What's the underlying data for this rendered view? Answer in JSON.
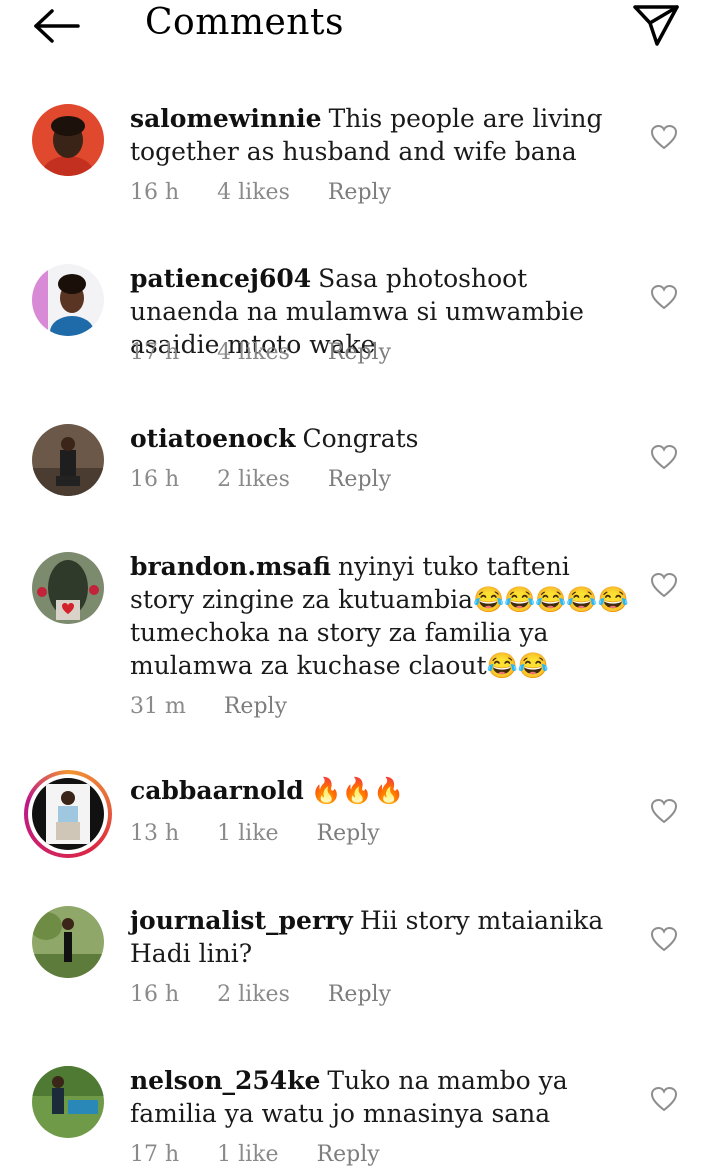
{
  "header": {
    "title": "Comments",
    "back_icon": "arrow-left-icon",
    "send_icon": "paper-plane-icon"
  },
  "comments": [
    {
      "username": "salomewinnie",
      "text": "This people are living together as husband and wife bana",
      "time": "16 h",
      "likes": "4 likes",
      "reply": "Reply"
    },
    {
      "username": "patiencej604",
      "text": "Sasa photoshoot unaenda na mulamwa si umwambie asaidie mtoto wake",
      "time": "17 h",
      "likes": "4 likes",
      "reply": "Reply"
    },
    {
      "username": "otiatoenock",
      "text": "Congrats",
      "time": "16 h",
      "likes": "2 likes",
      "reply": "Reply"
    },
    {
      "username": "brandon.msafi",
      "text": "nyinyi tuko tafteni story zingine za kutuambia😂😂😂😂😂 tumechoka na story za familia ya mulamwa za kuchase claout😂😂",
      "time": "31 m",
      "reply": "Reply"
    },
    {
      "username": "cabbaarnold",
      "text": "🔥🔥🔥",
      "time": "13 h",
      "likes": "1 like",
      "reply": "Reply"
    },
    {
      "username": "journalist_perry",
      "text": "Hii story mtaianika Hadi lini?",
      "time": "16 h",
      "likes": "2 likes",
      "reply": "Reply"
    },
    {
      "username": "nelson_254ke",
      "text": "Tuko na mambo ya familia ya watu jo mnasinya sana",
      "time": "17 h",
      "likes": "1 like",
      "reply": "Reply"
    }
  ],
  "colors": {
    "text": "#111111",
    "meta": "#8a8a8a",
    "story_ring": "#dc2743"
  }
}
